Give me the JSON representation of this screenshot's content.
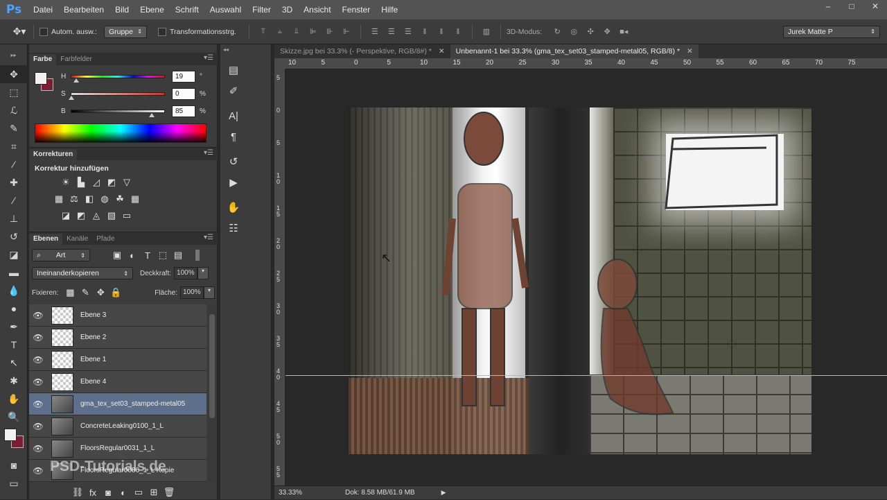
{
  "app": {
    "logo": "Ps"
  },
  "menu": [
    "Datei",
    "Bearbeiten",
    "Bild",
    "Ebene",
    "Schrift",
    "Auswahl",
    "Filter",
    "3D",
    "Ansicht",
    "Fenster",
    "Hilfe"
  ],
  "window_controls": {
    "minimize": "–",
    "maximize": "□",
    "close": "✕"
  },
  "options": {
    "auto_select_label": "Autom. ausw.:",
    "auto_select_value": "Gruppe",
    "transform_label": "Transformationsstrg.",
    "mode_3d_label": "3D-Modus:",
    "workspace": "Jurek Matte P"
  },
  "panels": {
    "color_tabs": [
      "Farbe",
      "Farbfelder"
    ],
    "sliders": [
      {
        "letter": "H",
        "value": "19",
        "unit": "°",
        "pos": 0.05
      },
      {
        "letter": "S",
        "value": "0",
        "unit": "%",
        "pos": 0.0
      },
      {
        "letter": "B",
        "value": "85",
        "unit": "%",
        "pos": 0.85
      }
    ],
    "adjust_tab": "Korrekturen",
    "adjust_title": "Korrektur hinzufügen",
    "layers_tabs": [
      "Ebenen",
      "Kanäle",
      "Pfade"
    ],
    "filter_kind": "Art",
    "blend_mode": "Ineinanderkopieren",
    "opacity_label": "Deckkraft:",
    "opacity_value": "100%",
    "fix_label": "Fixieren:",
    "fill_label": "Fläche:",
    "fill_value": "100%",
    "layers": [
      {
        "name": "Ebene 3",
        "selected": false,
        "texture": false
      },
      {
        "name": "Ebene 2",
        "selected": false,
        "texture": false
      },
      {
        "name": "Ebene 1",
        "selected": false,
        "texture": false
      },
      {
        "name": "Ebene 4",
        "selected": false,
        "texture": false
      },
      {
        "name": "gma_tex_set03_stamped-metal05",
        "selected": true,
        "texture": true
      },
      {
        "name": "ConcreteLeaking0100_1_L",
        "selected": false,
        "texture": true
      },
      {
        "name": "FloorsRegular0031_1_L",
        "selected": false,
        "texture": true
      },
      {
        "name": "FloorsRegular0086_1_L Kopie",
        "selected": false,
        "texture": true
      }
    ],
    "watermark": "PSD-Tutorials.de"
  },
  "doc_tabs": [
    {
      "label": "Skizze.jpg bei 33.3% (- Perspektive, RGB/8#) *",
      "active": false
    },
    {
      "label": "Unbenannt-1 bei 33.3% (gma_tex_set03_stamped-metal05, RGB/8) *",
      "active": true
    }
  ],
  "ruler_top": [
    "10",
    "5",
    "0",
    "5",
    "10",
    "15",
    "20",
    "25",
    "30",
    "35",
    "40",
    "45",
    "50",
    "55",
    "60",
    "65",
    "70",
    "75"
  ],
  "ruler_left": [
    "5",
    "0",
    "5",
    "1 0",
    "1 5",
    "2 0",
    "2 5",
    "3 0",
    "3 5",
    "4 0",
    "4 5",
    "5 0",
    "5 5"
  ],
  "status": {
    "zoom": "33.33%",
    "doc": "Dok: 8.58 MB/61.9 MB"
  },
  "colors": {
    "accent": "#4aa3ff",
    "fg_swatch": "#f2f2f2",
    "bg_swatch": "#7a1f33",
    "guide": "#6fd6d2"
  }
}
